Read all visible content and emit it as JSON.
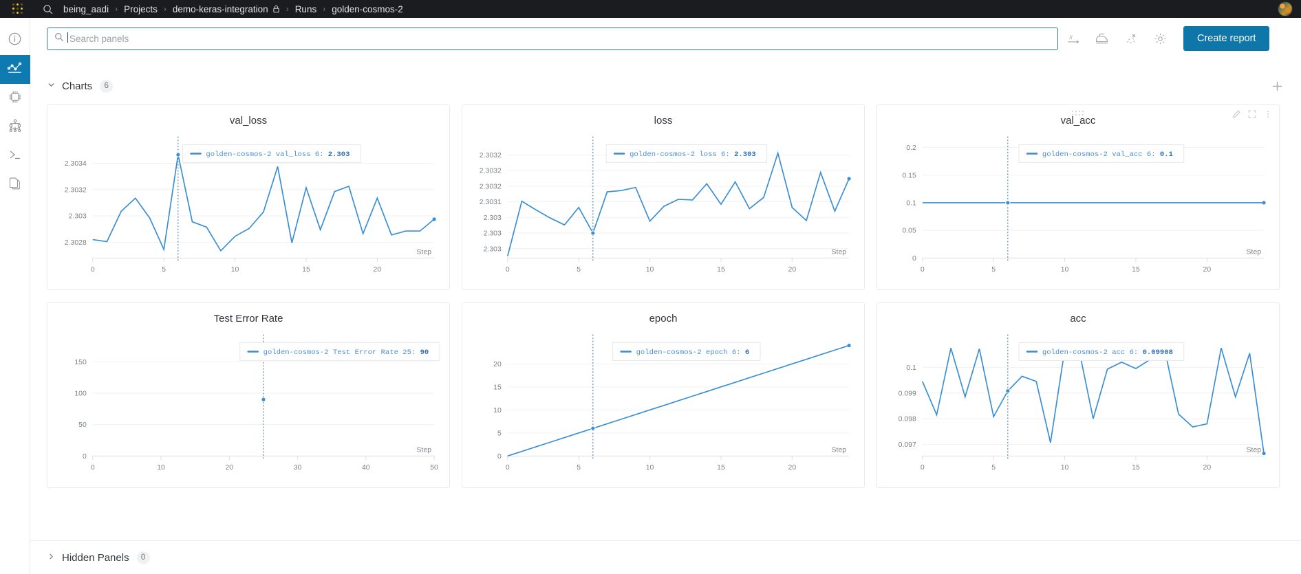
{
  "topbar": {
    "logo": "weights-and-biases-waffle",
    "search_icon": "search-icon",
    "breadcrumb": [
      {
        "label": "being_aadi",
        "icon": null
      },
      {
        "label": "Projects",
        "icon": null
      },
      {
        "label": "demo-keras-integration",
        "icon": "lock-icon"
      },
      {
        "label": "Runs",
        "icon": null
      },
      {
        "label": "golden-cosmos-2",
        "icon": null
      }
    ],
    "separator": "›",
    "avatar": "user-avatar"
  },
  "sidebar": {
    "items": [
      {
        "name": "overview",
        "icon": "info-circle-icon",
        "active": false
      },
      {
        "name": "charts",
        "icon": "line-chart-icon",
        "active": true
      },
      {
        "name": "system",
        "icon": "cpu-chip-icon",
        "active": false
      },
      {
        "name": "model",
        "icon": "model-graph-icon",
        "active": false
      },
      {
        "name": "logs",
        "icon": "terminal-icon",
        "active": false
      },
      {
        "name": "files",
        "icon": "files-icon",
        "active": false
      }
    ]
  },
  "toolbar": {
    "search": {
      "value": "",
      "placeholder": "Search panels",
      "icon": "search-icon"
    },
    "icons": [
      {
        "name": "x-axis-icon",
        "label": "x"
      },
      {
        "name": "smoothing-iron-icon",
        "label": ""
      },
      {
        "name": "outliers-scatter-icon",
        "label": ""
      },
      {
        "name": "gear-icon",
        "label": ""
      }
    ],
    "create_report_label": "Create report"
  },
  "sections": {
    "charts": {
      "title": "Charts",
      "count": "6",
      "expanded": true,
      "chevron": "chevron-down-icon"
    },
    "hidden": {
      "title": "Hidden Panels",
      "count": "0",
      "expanded": false,
      "chevron": "chevron-right-icon"
    },
    "add_panel_icon": "plus-icon"
  },
  "panel_controls": {
    "drag_icon": "drag-dots-icon",
    "edit_icon": "pencil-icon",
    "fullscreen_icon": "fullscreen-icon",
    "more_icon": "more-vertical-icon"
  },
  "colors": {
    "accent": "#0e76a8",
    "series": "#3b8fd4",
    "topbar_bg": "#1a1c1f",
    "legend_text": "#4b8fd6"
  },
  "chart_data": [
    {
      "id": "val_loss",
      "type": "line",
      "title": "val_loss",
      "xlabel": "Step",
      "ylabel": "",
      "grid": true,
      "legend_position": "top-center",
      "legend": [
        {
          "run": "golden-cosmos-2",
          "metric": "val_loss",
          "step": "6",
          "value": "2.303"
        }
      ],
      "cursor_step": 6,
      "xticks": [
        0,
        5,
        10,
        15,
        20
      ],
      "yticks": [
        "2.3028",
        "2.303",
        "2.3032",
        "2.3034"
      ],
      "ytick_values": [
        2.3028,
        2.303,
        2.3032,
        2.3034
      ],
      "xlim": [
        0,
        24
      ],
      "ylim": [
        2.30268,
        2.30352
      ],
      "series": [
        {
          "name": "golden-cosmos-2 val_loss",
          "x": [
            0,
            1,
            2,
            3,
            4,
            5,
            6,
            7,
            8,
            9,
            10,
            11,
            12,
            13,
            14,
            15,
            16,
            17,
            18,
            19,
            20,
            21,
            22,
            23,
            24
          ],
          "values": [
            2.30282,
            2.302805,
            2.303035,
            2.303135,
            2.302985,
            2.302745,
            2.303465,
            2.302955,
            2.302915,
            2.302735,
            2.302845,
            2.302905,
            2.30303,
            2.303375,
            2.302795,
            2.303215,
            2.302895,
            2.303185,
            2.303225,
            2.302865,
            2.303135,
            2.302855,
            2.302885,
            2.302885,
            2.302975
          ]
        }
      ]
    },
    {
      "id": "loss",
      "type": "line",
      "title": "loss",
      "xlabel": "Step",
      "ylabel": "",
      "grid": true,
      "legend_position": "top-center",
      "legend": [
        {
          "run": "golden-cosmos-2",
          "metric": "loss",
          "step": "6",
          "value": "2.303"
        }
      ],
      "cursor_step": 6,
      "xticks": [
        0,
        5,
        10,
        15,
        20
      ],
      "yticks": [
        "2.3032",
        "2.3032",
        "2.3032",
        "2.3031",
        "2.303",
        "2.303",
        "2.303"
      ],
      "ytick_values": [
        2.30321,
        2.303185,
        2.30316,
        2.303135,
        2.30311,
        2.303085,
        2.30306
      ],
      "xlim": [
        0,
        24
      ],
      "ylim": [
        2.303045,
        2.303222
      ],
      "series": [
        {
          "name": "golden-cosmos-2 loss",
          "x": [
            0,
            1,
            2,
            3,
            4,
            5,
            6,
            7,
            8,
            9,
            10,
            11,
            12,
            13,
            14,
            15,
            16,
            17,
            18,
            19,
            20,
            21,
            22,
            23,
            24
          ],
          "values": [
            2.303048,
            2.303136,
            2.303122,
            2.303109,
            2.303098,
            2.303126,
            2.303085,
            2.303151,
            2.303153,
            2.303158,
            2.303104,
            2.303128,
            2.303139,
            2.303138,
            2.303164,
            2.303131,
            2.303167,
            2.303124,
            2.303142,
            2.303213,
            2.303126,
            2.303105,
            2.303182,
            2.30312,
            2.303172
          ]
        }
      ]
    },
    {
      "id": "val_acc",
      "type": "line",
      "title": "val_acc",
      "xlabel": "Step",
      "ylabel": "",
      "grid": true,
      "legend_position": "top-center",
      "legend": [
        {
          "run": "golden-cosmos-2",
          "metric": "val_acc",
          "step": "6",
          "value": "0.1"
        }
      ],
      "cursor_step": 6,
      "xticks": [
        0,
        5,
        10,
        15,
        20
      ],
      "yticks": [
        "0",
        "0.05",
        "0.1",
        "0.15",
        "0.2"
      ],
      "ytick_values": [
        0,
        0.05,
        0.1,
        0.15,
        0.2
      ],
      "xlim": [
        0,
        24
      ],
      "ylim": [
        0,
        0.2
      ],
      "hover_controls": true,
      "series": [
        {
          "name": "golden-cosmos-2 val_acc",
          "x": [
            0,
            1,
            2,
            3,
            4,
            5,
            6,
            7,
            8,
            9,
            10,
            11,
            12,
            13,
            14,
            15,
            16,
            17,
            18,
            19,
            20,
            21,
            22,
            23,
            24
          ],
          "values": [
            0.1,
            0.1,
            0.1,
            0.1,
            0.1,
            0.1,
            0.1,
            0.1,
            0.1,
            0.1,
            0.1,
            0.1,
            0.1,
            0.1,
            0.1,
            0.1,
            0.1,
            0.1,
            0.1,
            0.1,
            0.1,
            0.1,
            0.1,
            0.1,
            0.1
          ]
        }
      ]
    },
    {
      "id": "test_error_rate",
      "type": "line",
      "title": "Test Error Rate",
      "xlabel": "Step",
      "ylabel": "",
      "grid": true,
      "legend_position": "top-right",
      "legend": [
        {
          "run": "golden-cosmos-2",
          "metric": "Test Error Rate",
          "step": "25",
          "value": "90"
        }
      ],
      "cursor_step": 25,
      "xticks": [
        0,
        10,
        20,
        30,
        40,
        50
      ],
      "yticks": [
        "0",
        "50",
        "100",
        "150"
      ],
      "ytick_values": [
        0,
        50,
        100,
        150
      ],
      "xlim": [
        0,
        50
      ],
      "ylim": [
        0,
        176
      ],
      "series": [
        {
          "name": "golden-cosmos-2 Test Error Rate",
          "x": [
            25
          ],
          "values": [
            90
          ]
        }
      ]
    },
    {
      "id": "epoch",
      "type": "line",
      "title": "epoch",
      "xlabel": "Step",
      "ylabel": "",
      "grid": true,
      "legend_position": "top-center",
      "legend": [
        {
          "run": "golden-cosmos-2",
          "metric": "epoch",
          "step": "6",
          "value": "6"
        }
      ],
      "cursor_step": 6,
      "xticks": [
        0,
        5,
        10,
        15,
        20
      ],
      "yticks": [
        "0",
        "5",
        "10",
        "15",
        "20"
      ],
      "ytick_values": [
        0,
        5,
        10,
        15,
        20
      ],
      "xlim": [
        0,
        24
      ],
      "ylim": [
        0,
        24
      ],
      "series": [
        {
          "name": "golden-cosmos-2 epoch",
          "x": [
            0,
            1,
            2,
            3,
            4,
            5,
            6,
            7,
            8,
            9,
            10,
            11,
            12,
            13,
            14,
            15,
            16,
            17,
            18,
            19,
            20,
            21,
            22,
            23,
            24
          ],
          "values": [
            0,
            1,
            2,
            3,
            4,
            5,
            6,
            7,
            8,
            9,
            10,
            11,
            12,
            13,
            14,
            15,
            16,
            17,
            18,
            19,
            20,
            21,
            22,
            23,
            24
          ]
        }
      ]
    },
    {
      "id": "acc",
      "type": "line",
      "title": "acc",
      "xlabel": "Step",
      "ylabel": "",
      "grid": true,
      "legend_position": "top-center",
      "legend": [
        {
          "run": "golden-cosmos-2",
          "metric": "acc",
          "step": "6",
          "value": "0.09908"
        }
      ],
      "cursor_step": 6,
      "xticks": [
        0,
        5,
        10,
        15,
        20
      ],
      "yticks": [
        "0.097",
        "0.098",
        "0.099",
        "0.1"
      ],
      "ytick_values": [
        0.097,
        0.098,
        0.099,
        0.1
      ],
      "xlim": [
        0,
        24
      ],
      "ylim": [
        0.09655,
        0.10085
      ],
      "series": [
        {
          "name": "golden-cosmos-2 acc",
          "x": [
            0,
            1,
            2,
            3,
            4,
            5,
            6,
            7,
            8,
            9,
            10,
            11,
            12,
            13,
            14,
            15,
            16,
            17,
            18,
            19,
            20,
            21,
            22,
            23,
            24
          ],
          "values": [
            0.09945,
            0.09815,
            0.10075,
            0.09885,
            0.10072,
            0.09808,
            0.09908,
            0.09965,
            0.09945,
            0.09707,
            0.10068,
            0.1007,
            0.098,
            0.09993,
            0.1002,
            0.09995,
            0.1003,
            0.10075,
            0.09818,
            0.09768,
            0.0978,
            0.10075,
            0.09885,
            0.10055,
            0.09665
          ]
        }
      ]
    }
  ]
}
